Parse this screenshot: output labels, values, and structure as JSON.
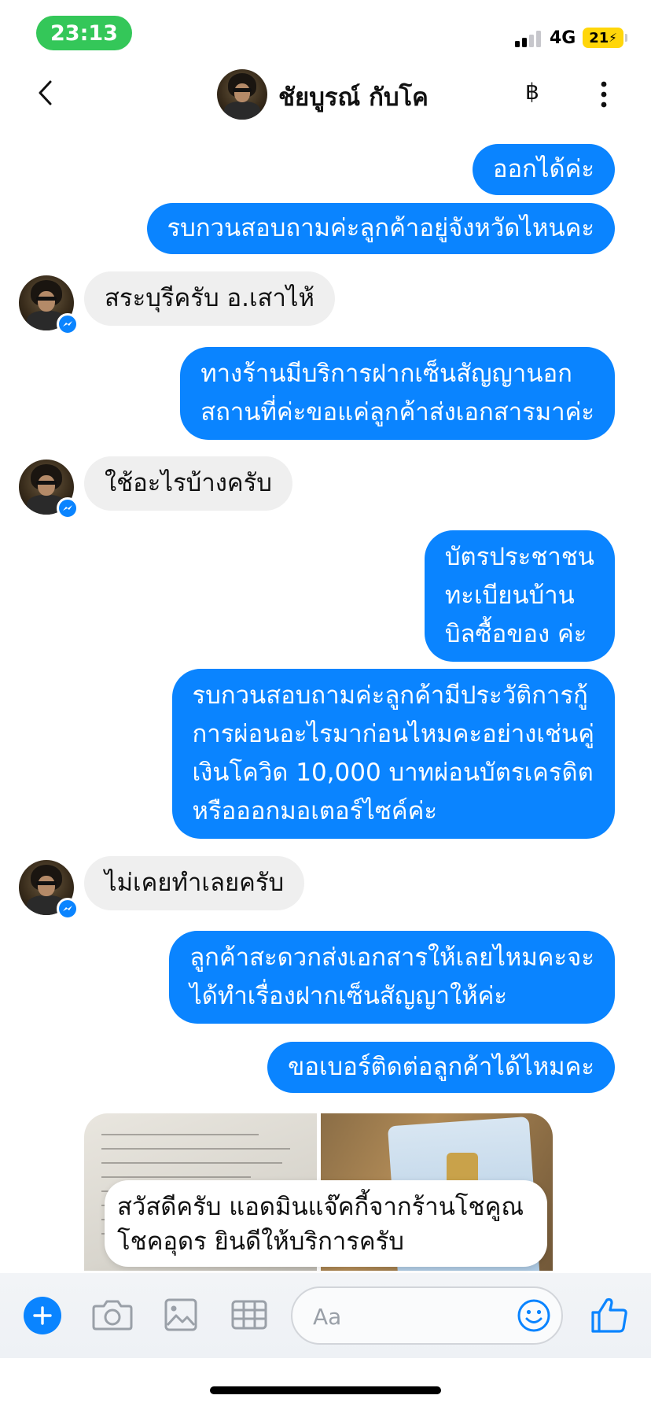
{
  "status_bar": {
    "time": "23:13",
    "network": "4G",
    "battery": "21",
    "battery_charging": true,
    "time_pill_color": "#34c759",
    "battery_color": "#ffd60a"
  },
  "header": {
    "contact_name": "ชัยบูรณ์ กับโค",
    "icons": [
      "back-icon",
      "avatar",
      "baht-icon",
      "more-vertical-icon"
    ]
  },
  "messages": [
    {
      "direction": "out",
      "text": "ออกได้ค่ะ"
    },
    {
      "direction": "out",
      "text": "รบกวนสอบถามค่ะลูกค้าอยู่จังหวัดไหนคะ"
    },
    {
      "direction": "in",
      "text": "สระบุรีครับ อ.เสาไห้"
    },
    {
      "direction": "out",
      "lines": [
        "ทางร้านมีบริการฝากเซ็นสัญญานอก",
        "สถานที่ค่ะขอแค่ลูกค้าส่งเอกสารมาค่ะ"
      ]
    },
    {
      "direction": "in",
      "text": "ใช้อะไรบ้างครับ"
    },
    {
      "direction": "out",
      "lines": [
        "บัตรประชาชน",
        "ทะเบียนบ้าน",
        "บิลซื้อของ ค่ะ"
      ]
    },
    {
      "direction": "out",
      "lines": [
        "รบกวนสอบถามค่ะลูกค้ามีประวัติการกู้",
        "การผ่อนอะไรมาก่อนไหมคะอย่างเช่นคู่",
        "เงินโควิด 10,000 บาทผ่อนบัตรเครดิต",
        "หรือออกมอเตอร์ไซค์ค่ะ"
      ]
    },
    {
      "direction": "in",
      "text": "ไม่เคยทำเลยครับ"
    },
    {
      "direction": "out",
      "lines": [
        "ลูกค้าสะดวกส่งเอกสารให้เลยไหมคะจะ",
        "ได้ทำเรื่องฝากเซ็นสัญญาให้ค่ะ"
      ]
    },
    {
      "direction": "out",
      "text": "ขอเบอร์ติดต่อลูกค้าได้ไหมคะ"
    },
    {
      "direction": "in",
      "type": "images",
      "images": [
        "document-photo",
        "id-card-photo"
      ]
    }
  ],
  "toast": {
    "lines": [
      "สวัสดีครับ แอดมินแจ๊คกี้จากร้านโชคูณ",
      "โชคอุดร ยินดีให้บริการครับ"
    ]
  },
  "composer": {
    "placeholder": "Aa",
    "icons": [
      "plus-icon",
      "camera-icon",
      "image-icon",
      "keyboard-icon",
      "emoji-icon",
      "thumbs-up-icon"
    ]
  },
  "colors": {
    "outgoing_bubble": "#0a84ff",
    "incoming_bubble": "#efefef",
    "accent": "#0a84ff"
  }
}
